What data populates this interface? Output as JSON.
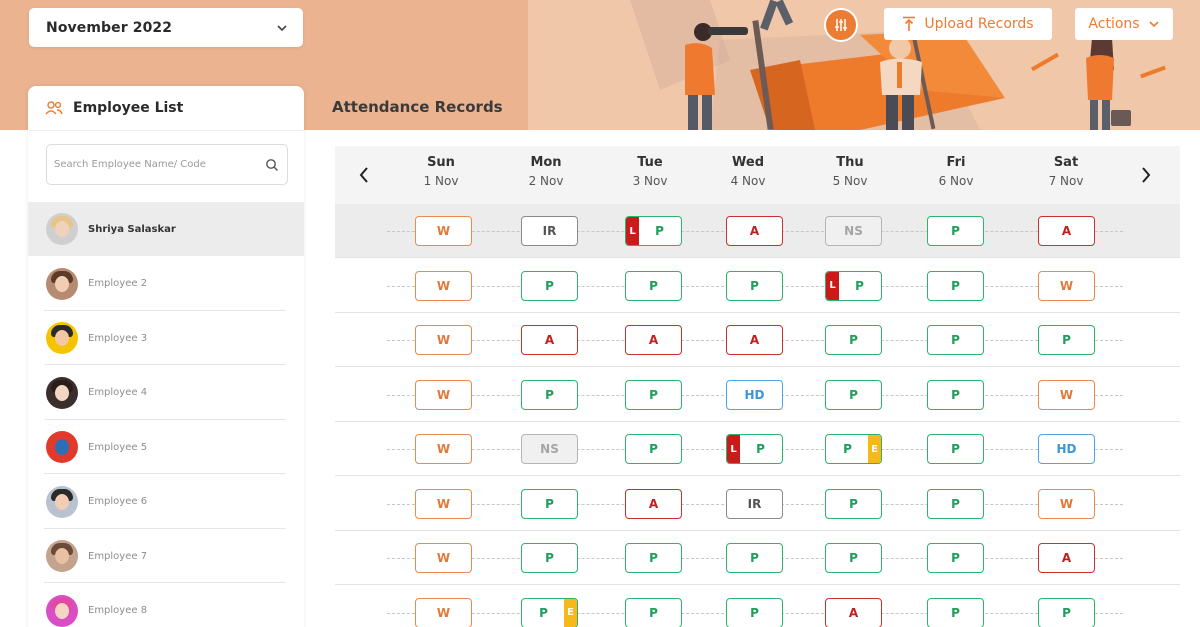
{
  "header": {
    "month": "November 2022",
    "upload_label": "Upload Records",
    "actions_label": "Actions",
    "records_title": "Attendance Records"
  },
  "employee_panel": {
    "title": "Employee List",
    "search_placeholder": "Search Employee Name/ Code",
    "employees": [
      {
        "name": "Shriya Salaskar",
        "active": true
      },
      {
        "name": "Employee 2"
      },
      {
        "name": "Employee 3"
      },
      {
        "name": "Employee 4"
      },
      {
        "name": "Employee 5"
      },
      {
        "name": "Employee 6"
      },
      {
        "name": "Employee 7"
      },
      {
        "name": "Employee 8"
      }
    ]
  },
  "calendar": {
    "days": [
      {
        "day": "Sun",
        "date": "1 Nov"
      },
      {
        "day": "Mon",
        "date": "2 Nov"
      },
      {
        "day": "Tue",
        "date": "3 Nov"
      },
      {
        "day": "Wed",
        "date": "4 Nov"
      },
      {
        "day": "Thu",
        "date": "5 Nov"
      },
      {
        "day": "Fri",
        "date": "6 Nov"
      },
      {
        "day": "Sat",
        "date": "7 Nov"
      }
    ],
    "rows": [
      [
        {
          "code": "W"
        },
        {
          "code": "IR"
        },
        {
          "code": "P",
          "left_tag": "L"
        },
        {
          "code": "A"
        },
        {
          "code": "NS"
        },
        {
          "code": "P"
        },
        {
          "code": "A"
        }
      ],
      [
        {
          "code": "W"
        },
        {
          "code": "P"
        },
        {
          "code": "P"
        },
        {
          "code": "P"
        },
        {
          "code": "P",
          "left_tag": "L"
        },
        {
          "code": "P"
        },
        {
          "code": "W"
        }
      ],
      [
        {
          "code": "W"
        },
        {
          "code": "A"
        },
        {
          "code": "A"
        },
        {
          "code": "A"
        },
        {
          "code": "P"
        },
        {
          "code": "P"
        },
        {
          "code": "P"
        }
      ],
      [
        {
          "code": "W"
        },
        {
          "code": "P"
        },
        {
          "code": "P"
        },
        {
          "code": "HD"
        },
        {
          "code": "P"
        },
        {
          "code": "P"
        },
        {
          "code": "W"
        }
      ],
      [
        {
          "code": "W"
        },
        {
          "code": "NS"
        },
        {
          "code": "P"
        },
        {
          "code": "P",
          "left_tag": "L"
        },
        {
          "code": "P",
          "right_tag": "E"
        },
        {
          "code": "P"
        },
        {
          "code": "HD"
        }
      ],
      [
        {
          "code": "W"
        },
        {
          "code": "P"
        },
        {
          "code": "A"
        },
        {
          "code": "IR"
        },
        {
          "code": "P"
        },
        {
          "code": "P"
        },
        {
          "code": "W"
        }
      ],
      [
        {
          "code": "W"
        },
        {
          "code": "P"
        },
        {
          "code": "P"
        },
        {
          "code": "P"
        },
        {
          "code": "P"
        },
        {
          "code": "P"
        },
        {
          "code": "A"
        }
      ],
      [
        {
          "code": "W"
        },
        {
          "code": "P",
          "right_tag": "E"
        },
        {
          "code": "P"
        },
        {
          "code": "P"
        },
        {
          "code": "A"
        },
        {
          "code": "P"
        },
        {
          "code": "P"
        }
      ]
    ]
  },
  "colors": {
    "accent": "#ec7b33",
    "header_bg": "#ebb390",
    "present": "#2cb36e",
    "absent": "#c8312e",
    "weekend": "#ec8a4e",
    "half_day": "#4aa6e8",
    "leave_tag": "#cc1a1a",
    "early_tag": "#f6b81a"
  },
  "icons": {
    "month_dropdown": "chevron-down-icon",
    "filter": "sliders-icon",
    "upload": "upload-icon",
    "actions": "chevron-down-icon",
    "employee_list": "users-icon",
    "search": "search-icon",
    "prev": "chevron-left-icon",
    "next": "chevron-right-icon"
  }
}
